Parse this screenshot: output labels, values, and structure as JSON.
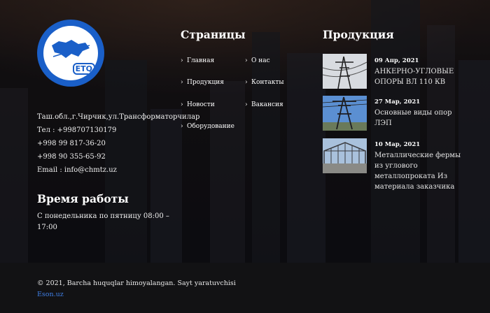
{
  "contacts": {
    "address": "Таш.обл.,г.Чирчик,ул.Трансформаторчилар",
    "tel1": "Тел : +998707130179",
    "tel2": "+998 99 817-36-20",
    "tel3": "+998 90 355-65-92",
    "email": "Email : info@chmtz.uz"
  },
  "hours": {
    "title": "Время работы",
    "line1": "С понедельника по пятницу 08:00 –",
    "line2": "17:00"
  },
  "logo": {
    "text": "ETQ"
  },
  "pages": {
    "title": "Страницы",
    "chevron": "›",
    "items": [
      "Главная",
      "О нас",
      "Продукция",
      "Контакты",
      "Новости",
      "Вакансия",
      "Оборудование"
    ]
  },
  "products": {
    "title": "Продукция",
    "items": [
      {
        "date": "09 Апр, 2021",
        "title": "АНКЕРНО-УГЛОВЫЕ ОПОРЫ ВЛ 110 КВ"
      },
      {
        "date": "27 Мар, 2021",
        "title": "Основные виды опор ЛЭП"
      },
      {
        "date": "10 Мар, 2021",
        "title": "Металлические фермы из углового металлопроката Из материала заказчика"
      }
    ]
  },
  "footer": {
    "copyright": "© 2021, Barcha huquqlar himoyalangan. Sayt yaratuvchisi",
    "link": "Eson.uz"
  }
}
